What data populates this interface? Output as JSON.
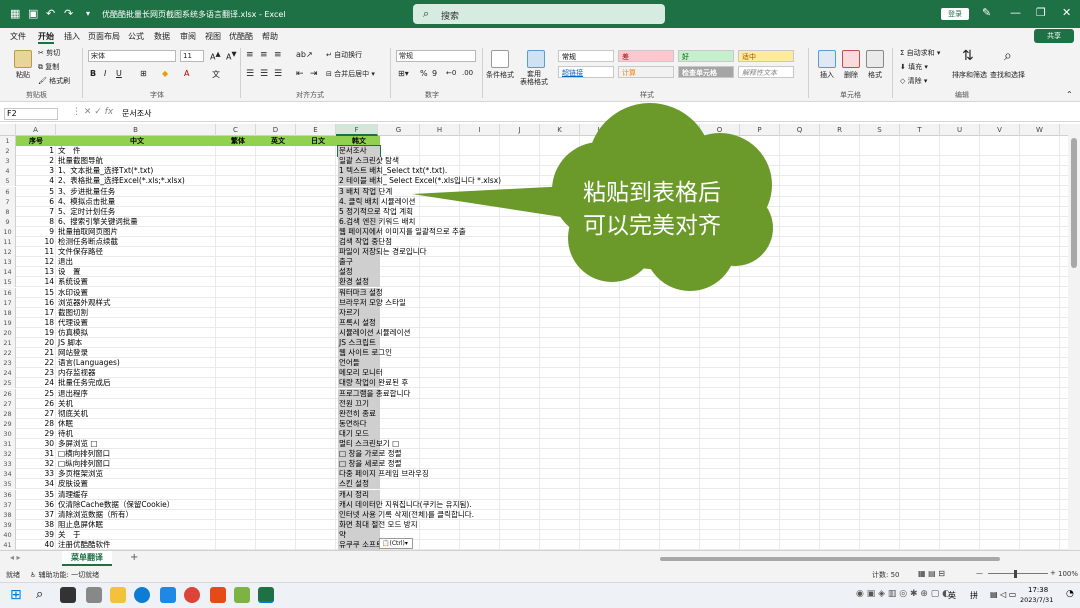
{
  "titlebar": {
    "filename": "优酷酷批量长网页截图系统多语言翻译.xlsx - Excel",
    "search_placeholder": "搜索",
    "login_label": "登录"
  },
  "menu": {
    "tabs": [
      "文件",
      "开始",
      "插入",
      "页面布局",
      "公式",
      "数据",
      "审阅",
      "视图",
      "优酷酷",
      "帮助"
    ],
    "active": "开始",
    "share_label": "共享"
  },
  "ribbon": {
    "clipboard": {
      "paste": "粘贴",
      "cut": "剪切",
      "copy": "复制",
      "painter": "格式刷",
      "group": "剪贴板"
    },
    "font": {
      "name": "宋体",
      "size": "11",
      "group": "字体"
    },
    "alignment": {
      "wrap": "自动换行",
      "merge": "合并后居中",
      "group": "对齐方式"
    },
    "number": {
      "format": "常规",
      "group": "数字"
    },
    "styles": {
      "conditional": "条件格式",
      "table": "套用\n表格格式",
      "cells": [
        {
          "label": "常规",
          "bg": "#ffffff",
          "fg": "#000000"
        },
        {
          "label": "差",
          "bg": "#ffc7ce",
          "fg": "#9c0006"
        },
        {
          "label": "好",
          "bg": "#c6efce",
          "fg": "#006100"
        },
        {
          "label": "适中",
          "bg": "#ffeb9c",
          "fg": "#9c5700"
        },
        {
          "label": "超链接",
          "bg": "#ffffff",
          "fg": "#0563c1"
        },
        {
          "label": "计算",
          "bg": "#f2f2f2",
          "fg": "#fa7d00"
        },
        {
          "label": "检查单元格",
          "bg": "#a5a5a5",
          "fg": "#ffffff"
        },
        {
          "label": "解释性文本",
          "bg": "#ffffff",
          "fg": "#7f7f7f"
        }
      ],
      "group": "样式"
    },
    "cells": {
      "insert": "插入",
      "delete": "删除",
      "format": "格式",
      "group": "单元格"
    },
    "editing": {
      "autosum": "自动求和",
      "fill": "填充",
      "clear": "清除",
      "sort": "排序和筛选",
      "find": "查找和选择",
      "group": "编辑"
    }
  },
  "formula": {
    "cell": "F2",
    "content": "문서조사"
  },
  "columns": [
    "A",
    "B",
    "C",
    "D",
    "E",
    "F",
    "G",
    "H",
    "I",
    "J",
    "K",
    "L",
    "M",
    "N",
    "O",
    "P",
    "Q",
    "R",
    "S",
    "T",
    "U",
    "V",
    "W"
  ],
  "selected_column": "F",
  "header_row": {
    "a": "序号",
    "b": "中文",
    "c": "繁体",
    "d": "英文",
    "e": "日文",
    "f": "韩文"
  },
  "rows": [
    {
      "n": "1",
      "zh": "文　件",
      "ko": "문서조사"
    },
    {
      "n": "2",
      "zh": "批量截图导航",
      "ko": "일괄 스크린샷 탐색"
    },
    {
      "n": "3",
      "zh": "1、文本批量_选择Txt(*.txt)",
      "ko": "1 텍스트 배치_Select  txt(*.txt)."
    },
    {
      "n": "4",
      "zh": "2、表格批量_选择Excel(*.xls;*.xlsx)",
      "ko": "2 테이블 배치_ Select  Excel(*.xls입니다 *.xlsx)"
    },
    {
      "n": "5",
      "zh": "3、步进批量任务",
      "ko": "3 배치 작업 단계"
    },
    {
      "n": "6",
      "zh": "4、模拟点击批量",
      "ko": "4. 클릭 배치 시뮬레이션"
    },
    {
      "n": "7",
      "zh": "5、定时计划任务",
      "ko": "5 정기적으로 작업  계획"
    },
    {
      "n": "8",
      "zh": "6、搜索引擎关键词批量",
      "ko": "6.검색 엔진 키워드 배치"
    },
    {
      "n": "9",
      "zh": "批量抽取网页图片",
      "ko": "웹 페이지에서  이미지를 일괄적으로 추출"
    },
    {
      "n": "10",
      "zh": "检测任务断点续截",
      "ko": "검색 작업 중단점"
    },
    {
      "n": "11",
      "zh": "文件保存路径",
      "ko": "파일이 저장되는 경로입니다"
    },
    {
      "n": "12",
      "zh": "退出",
      "ko": "출구"
    },
    {
      "n": "13",
      "zh": "设　置",
      "ko": "설정"
    },
    {
      "n": "14",
      "zh": "系统设置",
      "ko": "환경 설정"
    },
    {
      "n": "15",
      "zh": "水印设置",
      "ko": "워터마크 설정"
    },
    {
      "n": "16",
      "zh": "浏览器外观样式",
      "ko": "브라우저 모양 스타일"
    },
    {
      "n": "17",
      "zh": "截图切割",
      "ko": "자르기"
    },
    {
      "n": "18",
      "zh": "代理设置",
      "ko": "프록시 설정"
    },
    {
      "n": "19",
      "zh": "仿真模拟",
      "ko": "시뮬레이션 시뮬레이션"
    },
    {
      "n": "20",
      "zh": "JS 脚本",
      "ko": "JS  스크립트"
    },
    {
      "n": "21",
      "zh": "网站登录",
      "ko": "웹 사이트 로그인"
    },
    {
      "n": "22",
      "zh": "语言(Languages)",
      "ko": "언어들"
    },
    {
      "n": "23",
      "zh": "内存监视器",
      "ko": "메모리 모니터"
    },
    {
      "n": "24",
      "zh": "批量任务完成后",
      "ko": "대량 작업이 완료된  후"
    },
    {
      "n": "25",
      "zh": "退出程序",
      "ko": "프로그램을  종료합니다"
    },
    {
      "n": "26",
      "zh": "关机",
      "ko": "전원  끄기"
    },
    {
      "n": "27",
      "zh": "彻底关机",
      "ko": "완전히 종료"
    },
    {
      "n": "28",
      "zh": "休眠",
      "ko": "동면하다"
    },
    {
      "n": "29",
      "zh": "待机",
      "ko": "대기 모드"
    },
    {
      "n": "30",
      "zh": "多屏浏览 □",
      "ko": "멀티 스크린보기 □"
    },
    {
      "n": "31",
      "zh": "□横向排列窗口",
      "ko": "□ 창을  가로로 정렬"
    },
    {
      "n": "32",
      "zh": "□纵向排列窗口",
      "ko": "□ 창을  세로로 정렬"
    },
    {
      "n": "33",
      "zh": "多页框架浏览",
      "ko": "다중 페이지 프레임 브라우징"
    },
    {
      "n": "34",
      "zh": "皮肤设置",
      "ko": "스킨 설정"
    },
    {
      "n": "35",
      "zh": "清理缓存",
      "ko": "캐시  정리"
    },
    {
      "n": "36",
      "zh": "仅清除Cache数据（保留Cookie）",
      "ko": "캐시 데이터만 지워집니다(쿠키는  유지됨)."
    },
    {
      "n": "37",
      "zh": "清除浏览数据（所有）",
      "ko": "인터넷 사용 기록 삭제(전체)를 클릭합니다."
    },
    {
      "n": "38",
      "zh": "阻止息屏休眠",
      "ko": "화면 최대 절전 모드 방지"
    },
    {
      "n": "39",
      "zh": "关　于",
      "ko": "약"
    },
    {
      "n": "40",
      "zh": "注册优酷酷软件",
      "ko": "유쿠쿠 소프트웨어  등록"
    }
  ],
  "paste_tip": "(Ctrl)",
  "callout": {
    "line1": "粘贴到表格后",
    "line2": "可以完美对齐",
    "color": "#6b9a2b"
  },
  "sheet": {
    "tab": "菜单翻译",
    "add": "+"
  },
  "status": {
    "ready": "就绪",
    "accessibility": "辅助功能: 一切就绪",
    "count": "计数: 50",
    "zoom": "100%"
  },
  "taskbar": {
    "lang1": "英",
    "lang2": "拼",
    "time": "17:38",
    "date": "2023/7/31"
  }
}
